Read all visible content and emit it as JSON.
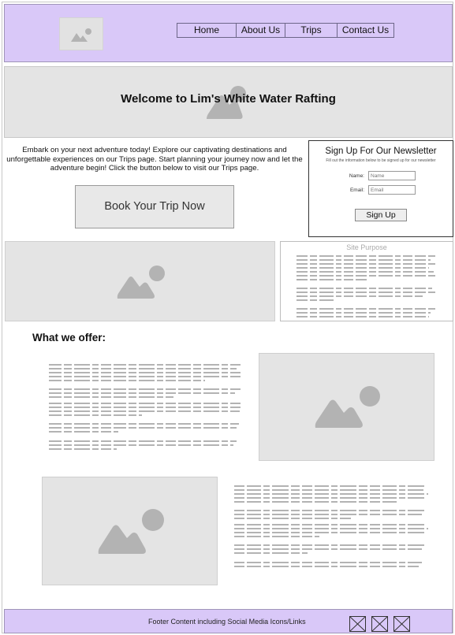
{
  "header": {
    "nav": [
      {
        "label": "Home"
      },
      {
        "label": "About Us"
      },
      {
        "label": "Trips"
      },
      {
        "label": "Contact Us"
      }
    ]
  },
  "hero": {
    "title": "Welcome to Lim's White Water Rafting"
  },
  "intro": {
    "text": "Embark on your next adventure today! Explore our captivating destinations and unforgettable experiences on our Trips page. Start planning your journey now and let the adventure begin! Click the button below to visit our Trips page.",
    "button_label": "Book Your Trip Now"
  },
  "newsletter": {
    "title": "Sign Up For Our Newsletter",
    "subtitle": "Fill out the information below to be signed up for our newsletter",
    "name_label": "Name:",
    "name_placeholder": "Name",
    "email_label": "Email:",
    "email_placeholder": "Email",
    "button_label": "Sign Up"
  },
  "purpose": {
    "title": "Site Purpose"
  },
  "offer": {
    "title": "What we offer:"
  },
  "footer": {
    "text": "Footer Content including Social Media Icons/Links"
  },
  "colors": {
    "header_bg": "#d9c8f8",
    "placeholder_gray": "#e4e4e4",
    "icon_gray": "#b3b3b3",
    "dummy_text_gray": "#9a9a9a"
  },
  "icons": [
    "image-placeholder-icon",
    "social-media-icon"
  ]
}
